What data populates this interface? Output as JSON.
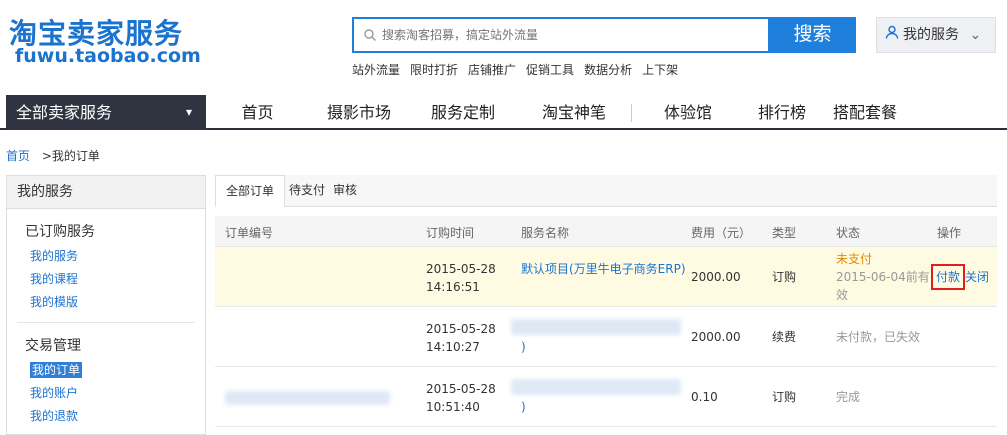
{
  "header": {
    "logo_cn": "淘宝卖家服务",
    "logo_en": "fuwu.taobao.com",
    "search_placeholder": "搜索淘客招募，搞定站外流量",
    "search_button": "搜索",
    "hot_links": [
      "站外流量",
      "限时打折",
      "店铺推广",
      "促销工具",
      "数据分析",
      "上下架"
    ],
    "my_service": "我的服务"
  },
  "nav": {
    "all_services": "全部卖家服务",
    "items": [
      "首页",
      "摄影市场",
      "服务定制",
      "淘宝神笔",
      "体验馆",
      "排行榜",
      "搭配套餐"
    ]
  },
  "breadcrumb": {
    "home": "首页",
    "current": ">我的订单"
  },
  "sidebar": {
    "title": "我的服务",
    "groups": [
      {
        "title": "已订购服务",
        "links": [
          "我的服务",
          "我的课程",
          "我的模版"
        ]
      },
      {
        "title": "交易管理",
        "links": [
          "我的订单",
          "我的账户",
          "我的退款"
        ]
      }
    ]
  },
  "tabs": [
    "全部订单",
    "待支付",
    "审核"
  ],
  "table": {
    "headers": [
      "订单编号",
      "订购时间",
      "服务名称",
      "费用（元）",
      "类型",
      "状态",
      "操作"
    ],
    "rows": [
      {
        "time_date": "2015-05-28",
        "time_clock": "14:16:51",
        "name": "默认项目(万里牛电子商务ERP)",
        "fee": "2000.00",
        "type": "订购",
        "status_main": "未支付",
        "status_sub": "2015-06-04前有效",
        "op_pay": "付款",
        "op_close": "关闭"
      },
      {
        "time_date": "2015-05-28",
        "time_clock": "14:10:27",
        "name": ")",
        "fee": "2000.00",
        "type": "续费",
        "status_main": "未付款，已失效"
      },
      {
        "time_date": "2015-05-28",
        "time_clock": "10:51:40",
        "name": ")",
        "fee": "0.10",
        "type": "订购",
        "status_main": "完成"
      }
    ]
  },
  "colors": {
    "brand": "#1b73d0",
    "nav_dark": "#2f3440",
    "highlight_row": "#fffbe3",
    "alert_red": "#e21d1d",
    "unpaid_orange": "#e18a00"
  }
}
